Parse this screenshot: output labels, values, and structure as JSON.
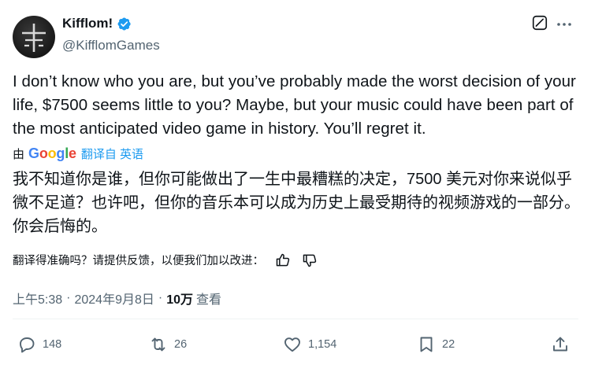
{
  "author": {
    "name": "Kifflom!",
    "handle": "@KifflomGames"
  },
  "tweet": {
    "text": "I don’t know who you are, but you’ve probably made the worst decision of your life, $7500 seems little to you? Maybe, but your music could have been part of the most anticipated video game in history. You’ll regret it.",
    "translate_by": "由",
    "translate_provider": "Google",
    "translate_from": "翻译自 英语",
    "translated_text": "我不知道你是谁，但你可能做出了一生中最糟糕的决定，7500 美元对你来说似乎微不足道？也许吧，但你的音乐本可以成为历史上最受期待的视频游戏的一部分。你会后悔的。",
    "feedback_prompt": "翻译得准确吗？请提供反馈，以便我们加以改进：",
    "time": "上午5:38",
    "date": "2024年9月8日",
    "separator": "·",
    "views_count": "10万",
    "views_label": "查看"
  },
  "actions": {
    "replies": "148",
    "reposts": "26",
    "likes": "1,154",
    "bookmarks": "22"
  },
  "icons": {
    "verified": "verified-badge-icon",
    "grok": "grok-icon",
    "more": "more-options-icon",
    "thumbs_up": "thumbs-up-icon",
    "thumbs_down": "thumbs-down-icon",
    "reply": "reply-icon",
    "repost": "repost-icon",
    "like": "heart-icon",
    "bookmark": "bookmark-icon",
    "share": "share-icon"
  },
  "colors": {
    "accent": "#1d9bf0",
    "text_primary": "#0f1419",
    "text_secondary": "#536471",
    "divider": "#eff3f4"
  }
}
